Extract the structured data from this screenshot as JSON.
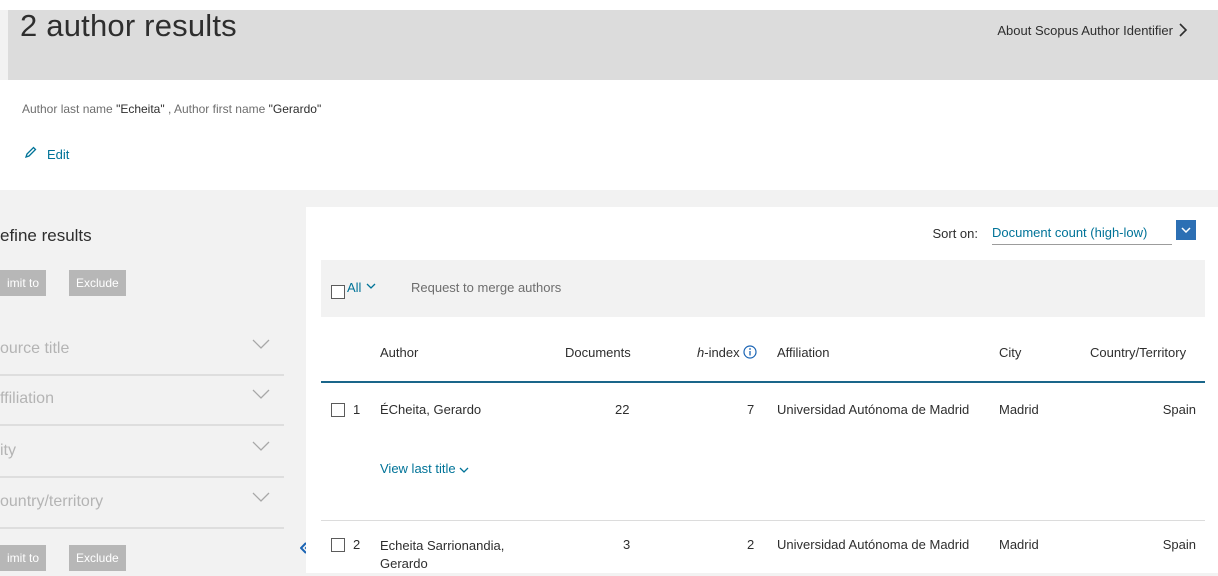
{
  "header": {
    "title": "2 author results",
    "about_link": "About Scopus Author Identifier"
  },
  "query": {
    "prefix1": "Author last name ",
    "last_name": "\"Echeita\"",
    "sep": " , Author first name ",
    "first_name": "\"Gerardo\""
  },
  "edit_label": "Edit",
  "refine": {
    "heading": "efine results",
    "limit_label": "imit to",
    "exclude_label": "Exclude",
    "facets": [
      "ource title",
      "ffiliation",
      "ity",
      "ountry/territory"
    ]
  },
  "sort": {
    "label": "Sort on:",
    "value": "Document count (high-low)"
  },
  "toolbar": {
    "all_label": "All",
    "merge_label": "Request to merge authors"
  },
  "table": {
    "columns": {
      "author": "Author",
      "documents": "Documents",
      "h_prefix": "h",
      "h_suffix": "-index",
      "affiliation": "Affiliation",
      "city": "City",
      "country": "Country/Territory"
    },
    "rows": [
      {
        "num": "1",
        "author": "ÉCheita, Gerardo",
        "author_line2": "",
        "documents": "22",
        "h_index": "7",
        "affiliation": "Universidad Autónoma de Madrid",
        "city": "Madrid",
        "country": "Spain",
        "view_last": "View last title"
      },
      {
        "num": "2",
        "author": "Echeita Sarrionandia,",
        "author_line2": "Gerardo",
        "documents": "3",
        "h_index": "2",
        "affiliation": "Universidad Autónoma de Madrid",
        "city": "Madrid",
        "country": "Spain"
      }
    ]
  },
  "colors": {
    "link": "#007398",
    "header_bg": "#dcdcdc",
    "accent_blue": "#2c6fb4",
    "table_rule": "#1a668a"
  }
}
